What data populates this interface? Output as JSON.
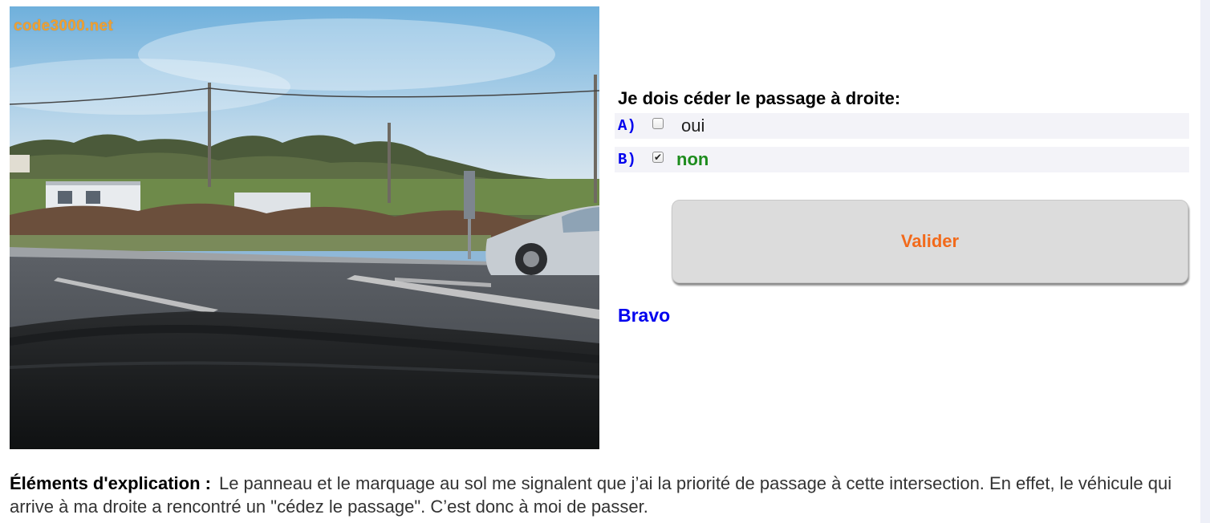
{
  "photo": {
    "watermark": "code3000.net"
  },
  "question": {
    "text": "Je dois céder le passage à droite:"
  },
  "answers": [
    {
      "letter": "A)",
      "text": "oui",
      "checked": false,
      "correct": false
    },
    {
      "letter": "B)",
      "text": "non",
      "checked": true,
      "correct": true
    }
  ],
  "validate_label": "Valider",
  "feedback": "Bravo",
  "explanation": {
    "label": "Éléments d'explication :",
    "text": "Le panneau et le marquage au sol me signalent que j’ai la priorité de passage à cette intersection. En effet, le véhicule qui arrive à ma droite a rencontré un \"cédez le passage\". C’est donc à moi de passer."
  },
  "colors": {
    "letter": "#0000ee",
    "correct_answer": "#1e8c1e",
    "validate_text": "#f26a1b",
    "feedback": "#0000ee",
    "watermark": "#f0a030"
  }
}
